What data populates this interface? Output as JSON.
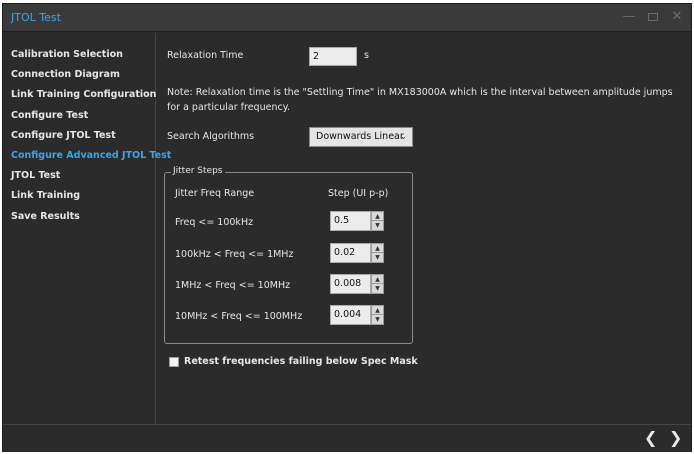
{
  "window": {
    "title": "JTOL Test"
  },
  "sidebar": {
    "items": [
      {
        "label": "Calibration Selection"
      },
      {
        "label": "Connection Diagram"
      },
      {
        "label": "Link Training Configuration"
      },
      {
        "label": "Configure Test"
      },
      {
        "label": "Configure JTOL Test"
      },
      {
        "label": "Configure Advanced JTOL Test",
        "active": true
      },
      {
        "label": "JTOL Test"
      },
      {
        "label": "Link Training"
      },
      {
        "label": "Save Results"
      }
    ]
  },
  "relaxation": {
    "label": "Relaxation Time",
    "value": "2",
    "unit": "s"
  },
  "note": "Note: Relaxation time is the \"Settling Time\" in MX183000A which is the interval between amplitude jumps for a particular frequency.",
  "search": {
    "label": "Search Algorithms",
    "selected": "Downwards Linear"
  },
  "jitter_steps": {
    "title": "Jitter Steps",
    "col_range": "Jitter Freq Range",
    "col_step": "Step (UI p-p)",
    "rows": [
      {
        "range": "Freq <= 100kHz",
        "step": "0.5"
      },
      {
        "range": "100kHz < Freq <= 1MHz",
        "step": "0.02"
      },
      {
        "range": "1MHz < Freq <= 10MHz",
        "step": "0.008"
      },
      {
        "range": "10MHz < Freq <= 100MHz",
        "step": "0.004"
      }
    ]
  },
  "retest": {
    "label": "Retest frequencies failing below Spec Mask",
    "checked": false
  },
  "colors": {
    "accent": "#3fa3e3",
    "background": "#2b2b2b"
  }
}
